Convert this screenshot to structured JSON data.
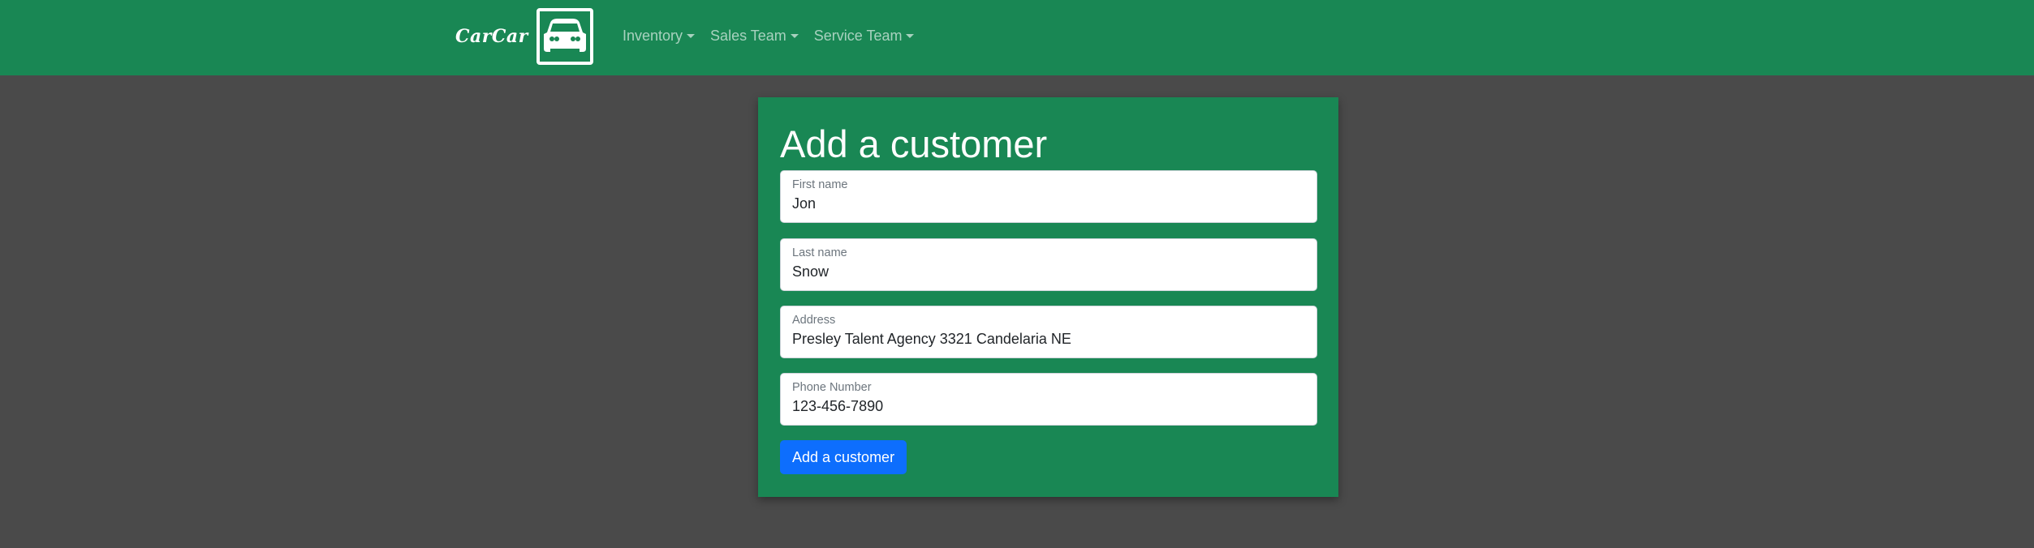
{
  "colors": {
    "navbar": "#198754",
    "background": "#4a4a4a",
    "card": "#198754",
    "primary_button": "#0d6efd"
  },
  "navbar": {
    "brand_text": "CarCar",
    "logo_icon": "car-front-icon",
    "links": [
      {
        "label": "Inventory"
      },
      {
        "label": "Sales Team"
      },
      {
        "label": "Service Team"
      }
    ]
  },
  "form": {
    "title": "Add a customer",
    "fields": {
      "first_name": {
        "label": "First name",
        "value": "Jon"
      },
      "last_name": {
        "label": "Last name",
        "value": "Snow"
      },
      "address": {
        "label": "Address",
        "value": "Presley Talent Agency 3321 Candelaria NE"
      },
      "phone": {
        "label": "Phone Number",
        "value": "123-456-7890"
      }
    },
    "submit_label": "Add a customer"
  }
}
